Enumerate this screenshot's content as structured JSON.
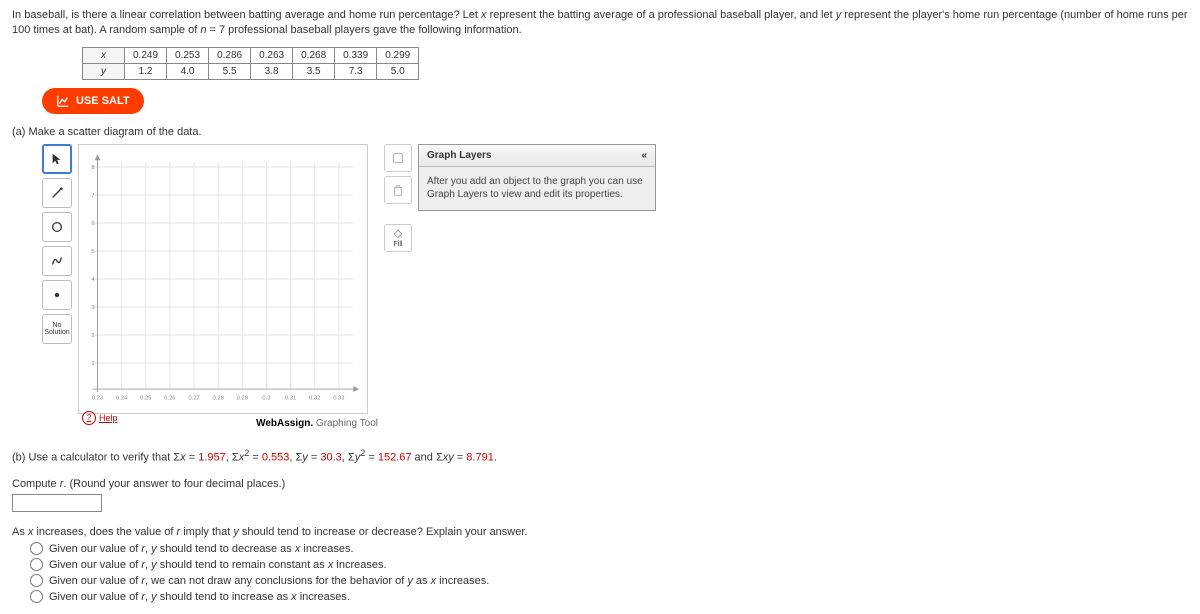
{
  "intro": {
    "line1_a": "In baseball, is there a linear correlation between batting average and home run percentage? Let ",
    "x": "x",
    "line1_b": " represent the batting average of a professional baseball player, and let ",
    "y": "y",
    "line1_c": " represent the player's home run percentage (number of home runs per 100 times at bat). A random sample of ",
    "n": "n",
    "eq": " = 7 professional baseball players gave the following information."
  },
  "table": {
    "row_x": "x",
    "row_y": "y",
    "x_vals": [
      "0.249",
      "0.253",
      "0.286",
      "0.263",
      "0.268",
      "0.339",
      "0.299"
    ],
    "y_vals": [
      "1.2",
      "4.0",
      "5.5",
      "3.8",
      "3.5",
      "7.3",
      "5.0"
    ]
  },
  "salt_label": "USE SALT",
  "part_a": "(a) Make a scatter diagram of the data.",
  "tools": {
    "fill": "Fill",
    "nosol": "No Solution",
    "help": "Help"
  },
  "layers": {
    "title": "Graph Layers",
    "collapse": "«",
    "desc": "After you add an object to the graph you can use Graph Layers to view and edit its properties."
  },
  "plot": {
    "x_ticks": [
      "0.23",
      "0.24",
      "0.25",
      "0.26",
      "0.27",
      "0.28",
      "0.29",
      "0.3",
      "0.31",
      "0.32",
      "0.33"
    ],
    "y_ticks": [
      "1",
      "2",
      "3",
      "4",
      "5",
      "6",
      "7",
      "8"
    ]
  },
  "brand_a": "WebAssign.",
  "brand_b": " Graphing Tool",
  "part_b": {
    "prefix": "(b) Use a calculator to verify that Σ",
    "x": "x",
    "eq1": " = ",
    "v1": "1.957",
    "c1": ", Σ",
    "x2": "x",
    "sup2": "2",
    "eq2": " = ",
    "v2": "0.553",
    "c2": ", Σ",
    "y": "y",
    "eq3": " = ",
    "v3": "30.3",
    "c3": ", Σ",
    "y2": "y",
    "eq4": " = ",
    "v4": "152.67",
    "c4": " and Σ",
    "xy": "xy",
    "eq5": " = ",
    "v5": "8.791",
    "end": ".",
    "compute_a": "Compute ",
    "r": "r",
    "compute_b": ". (Round your answer to four decimal places.)"
  },
  "part_c": {
    "q_a": "As ",
    "x": "x",
    "q_b": " increases, does the value of ",
    "r": "r",
    "q_c": " imply that ",
    "y": "y",
    "q_d": " should tend to increase or decrease? Explain your answer.",
    "opts": [
      {
        "a": "Given our value of ",
        "r": "r",
        "b": ", ",
        "y": "y",
        "c": " should tend to decrease as ",
        "x": "x",
        "d": " increases."
      },
      {
        "a": "Given our value of ",
        "r": "r",
        "b": ", ",
        "y": "y",
        "c": " should tend to remain constant as ",
        "x": "x",
        "d": " increases."
      },
      {
        "a": "Given our value of ",
        "r": "r",
        "b": ", we can not draw any conclusions for the behavior of ",
        "y": "y",
        "c": " as ",
        "x": "x",
        "d": " increases."
      },
      {
        "a": "Given our value of ",
        "r": "r",
        "b": ", ",
        "y": "y",
        "c": " should tend to increase as ",
        "x": "x",
        "d": " increases."
      }
    ]
  }
}
